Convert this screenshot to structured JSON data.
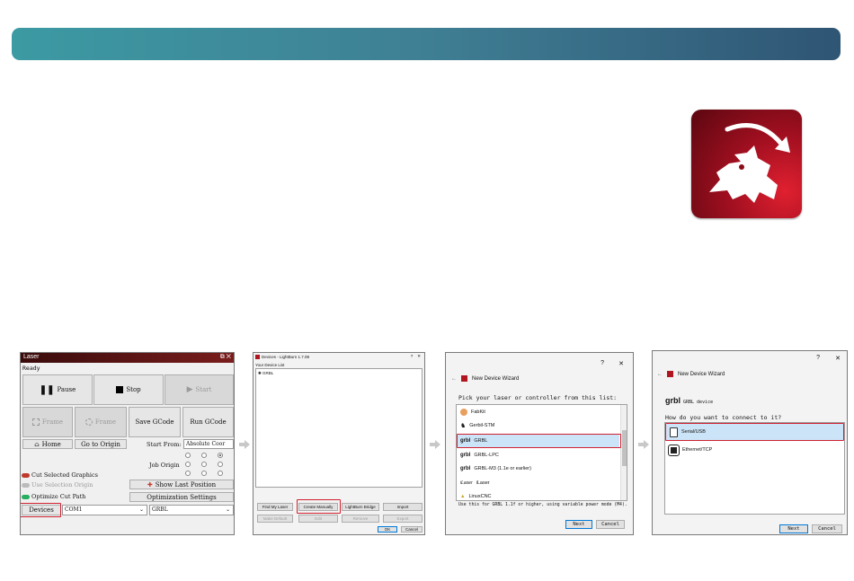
{
  "laser_panel": {
    "title": "Laser",
    "status": "Ready",
    "pause": "Pause",
    "stop": "Stop",
    "start": "Start",
    "frame1": "Frame",
    "frame2": "Frame",
    "save_gcode": "Save GCode",
    "run_gcode": "Run GCode",
    "home": "Home",
    "go_to_origin": "Go to Origin",
    "start_from_label": "Start From:",
    "start_from_value": "Absolute Coor",
    "job_origin": "Job Origin",
    "cut_selected": "Cut Selected Graphics",
    "use_selection_origin": "Use Selection Origin",
    "optimize_cut_path": "Optimize Cut Path",
    "show_last_position": "Show Last Position",
    "optimization_settings": "Optimization Settings",
    "devices": "Devices",
    "port_value": "COM1",
    "device_value": "GRBL"
  },
  "devices_panel": {
    "title": "Devices - LightBurn 1.7.08",
    "list_label": "Your Device List",
    "list_item": "GRBL",
    "find_my_laser": "Find My Laser",
    "create_manually": "Create Manually",
    "lightburn_bridge": "LightBurn Bridge",
    "import": "Import",
    "make_default": "Make Default",
    "edit": "Edit",
    "remove": "Remove",
    "export": "Export",
    "ok": "OK",
    "cancel": "Cancel"
  },
  "wizard_pick": {
    "question_mark": "?",
    "close": "✕",
    "title": "New Device Wizard",
    "prompt": "Pick your laser or controller from this list:",
    "items": [
      "FabKit",
      "Gerbil-STM",
      "GRBL",
      "GRBL-LPC",
      "GRBL-M3 (1.1e or earlier)",
      "iLaser",
      "LinuxCNC"
    ],
    "note": "Use this for GRBL 1.1f or higher, using variable power mode (M4).",
    "next": "Next",
    "cancel": "Cancel"
  },
  "wizard_connect": {
    "question_mark": "?",
    "close": "✕",
    "title": "New Device Wizard",
    "device_logo_text": "grbl",
    "device_label": "GRBL device",
    "prompt": "How do you want to connect to it?",
    "options": [
      "Serial/USB",
      "Ethernet/TCP"
    ],
    "next": "Next",
    "cancel": "Cancel"
  },
  "colors": {
    "banner_start": "#3c9aa3",
    "banner_end": "#2f5574",
    "highlight": "#d02030",
    "selection": "#cce4f7"
  }
}
